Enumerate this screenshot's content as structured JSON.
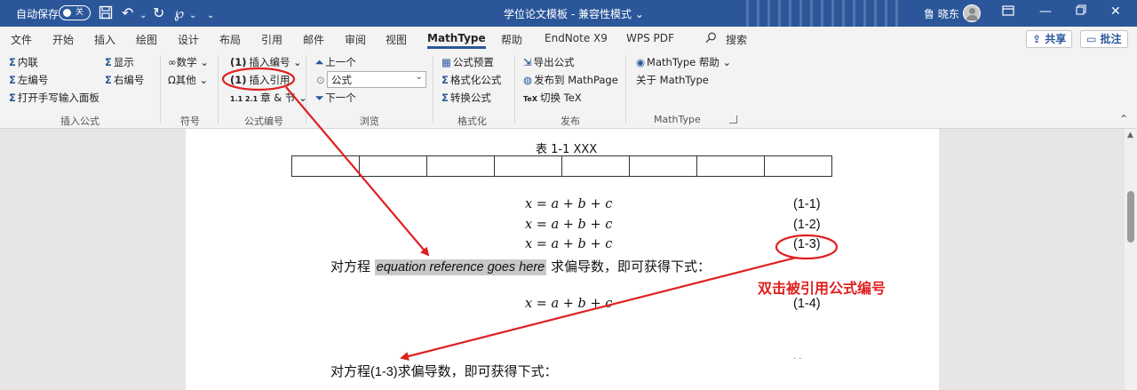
{
  "titlebar": {
    "autosave_label": "自动保存",
    "autosave_state": "关",
    "doc_title": "学位论文模板 - 兼容性模式 ⌄",
    "user_name": "鲁 晓东",
    "qat_dropdown": "⌄"
  },
  "menu": {
    "tabs": [
      "文件",
      "开始",
      "插入",
      "绘图",
      "设计",
      "布局",
      "引用",
      "邮件",
      "审阅",
      "视图",
      "MathType",
      "帮助",
      "EndNote X9",
      "WPS PDF"
    ],
    "active_tab": "MathType",
    "search_label": "搜索",
    "share_label": "共享",
    "comment_label": "批注"
  },
  "ribbon": {
    "insert_formula": {
      "group_name": "插入公式",
      "inline": "内联",
      "display": "显示",
      "left_number": "左编号",
      "right_number": "右编号",
      "handwriting_panel": "打开手写输入面板"
    },
    "symbols": {
      "group_name": "符号",
      "math": "数学",
      "other": "其他"
    },
    "equation_numbers": {
      "group_name": "公式编号",
      "insert_number": "插入编号",
      "insert_reference": "插入引用",
      "chapter_section": "章 & 节",
      "num_glyph": "(1)",
      "ref_glyph": "(1)",
      "chapter_glyph": "1.1 2.1"
    },
    "browse": {
      "group_name": "浏览",
      "previous": "上一个",
      "combo_value": "公式",
      "next": "下一个"
    },
    "format": {
      "group_name": "格式化",
      "preview": "公式预置",
      "format_equations": "格式化公式",
      "convert": "转换公式"
    },
    "publish": {
      "group_name": "发布",
      "export": "导出公式",
      "publish_mathpage": "发布到 MathPage",
      "toggle_tex": "切换 TeX",
      "tex_glyph": "TeX"
    },
    "mathtype": {
      "group_name": "MathType",
      "help": "MathType 帮助",
      "about": "关于 MathType"
    }
  },
  "document": {
    "table_caption": "表  1-1   XXX",
    "table_columns": 8,
    "equations": [
      {
        "expr": "x = a + b + c",
        "num": "(1-1)"
      },
      {
        "expr": "x = a + b + c",
        "num": "(1-2)"
      },
      {
        "expr": "x = a + b + c",
        "num": "(1-3)"
      },
      {
        "expr": "x = a + b + c",
        "num": "(1-4)"
      }
    ],
    "para1_prefix": "对方程 ",
    "para1_field": "equation reference goes here",
    "para1_suffix": " 求偏导数，即可获得下式：",
    "para2_prefix": "对方程",
    "para2_ref": "(1-3)",
    "para2_suffix": "求偏导数，即可获得下式：",
    "trailing_dots": ".       ."
  },
  "annotation": {
    "text": "双击被引用公式编号",
    "color": "#e02020"
  },
  "colors": {
    "title_bar": "#2b579a",
    "ribbon_bg": "#f3f3f3",
    "annotation_red": "#e02020"
  }
}
